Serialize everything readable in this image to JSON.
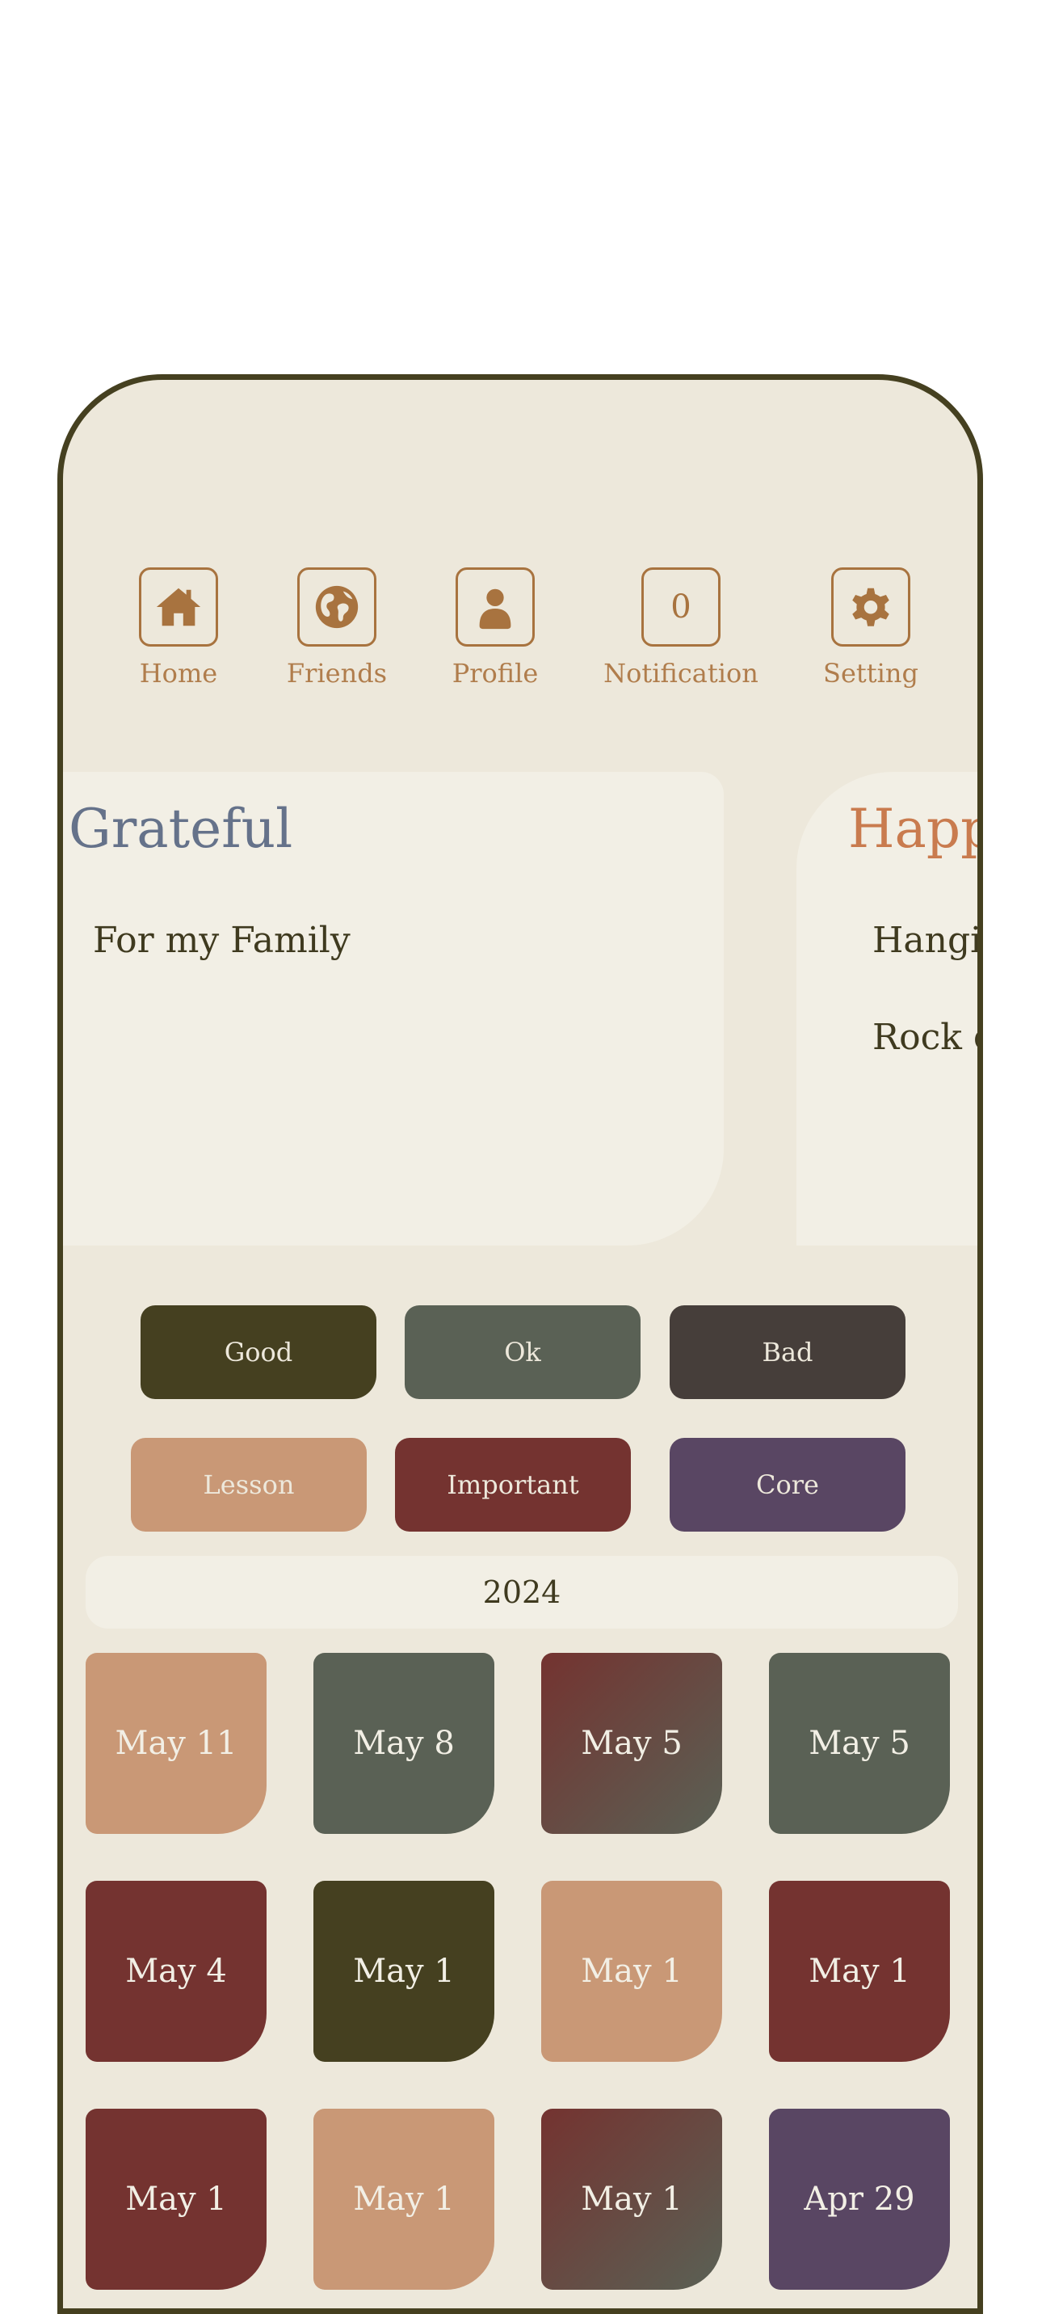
{
  "nav": [
    {
      "label": "Home",
      "icon": "home-icon"
    },
    {
      "label": "Friends",
      "icon": "globe-icon"
    },
    {
      "label": "Profile",
      "icon": "person-icon"
    },
    {
      "label": "Notification",
      "icon": "notification-count",
      "count": "0"
    },
    {
      "label": "Setting",
      "icon": "gear-icon"
    }
  ],
  "cards": [
    {
      "title": "Grateful",
      "title_color": "#65728a",
      "lines": [
        "For my Family"
      ]
    },
    {
      "title": "Happ",
      "title_color": "#c97b4e",
      "lines": [
        "Hangi",
        "Rock c"
      ]
    }
  ],
  "moods": [
    {
      "label": "Good",
      "color": "#454020"
    },
    {
      "label": "Ok",
      "color": "#5a6155"
    },
    {
      "label": "Bad",
      "color": "#463e3a"
    },
    {
      "label": "Lesson",
      "color": "#c99876"
    },
    {
      "label": "Important",
      "color": "#743330"
    },
    {
      "label": "Core",
      "color": "#594663"
    }
  ],
  "year": "2024",
  "entries": [
    {
      "date": "May 11",
      "color": "#c99876"
    },
    {
      "date": "May 8",
      "color": "#5a6155"
    },
    {
      "date": "May 5",
      "color": "#743330",
      "color2": "#5a6155"
    },
    {
      "date": "May 5",
      "color": "#5a6155"
    },
    {
      "date": "May 4",
      "color": "#743330"
    },
    {
      "date": "May 1",
      "color": "#454020"
    },
    {
      "date": "May 1",
      "color": "#c99876"
    },
    {
      "date": "May 1",
      "color": "#743330"
    },
    {
      "date": "May 1",
      "color": "#743330"
    },
    {
      "date": "May 1",
      "color": "#c99876"
    },
    {
      "date": "May 1",
      "color": "#743330",
      "color2": "#5a6155"
    },
    {
      "date": "Apr 29",
      "color": "#594663"
    }
  ]
}
